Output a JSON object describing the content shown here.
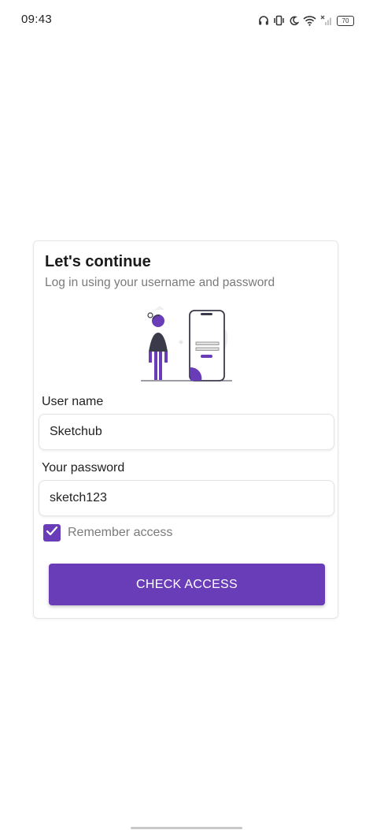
{
  "status_bar": {
    "time": "09:43",
    "battery": "70",
    "icons": [
      "headphones-icon",
      "vibrate-icon",
      "moon-icon",
      "wifi-icon",
      "signal-off-icon",
      "battery-icon"
    ]
  },
  "login_card": {
    "title": "Let's continue",
    "subtitle": "Log in using your username and password",
    "illustration": "person-with-phone-illustration",
    "username": {
      "label": "User name",
      "value": "Sketchub"
    },
    "password": {
      "label": "Your password",
      "value": "sketch123"
    },
    "remember": {
      "label": "Remember access",
      "checked": true
    },
    "submit_label": "CHECK ACCESS"
  },
  "colors": {
    "accent": "#6a3db8",
    "subtitle_text": "#7a7a7a"
  }
}
